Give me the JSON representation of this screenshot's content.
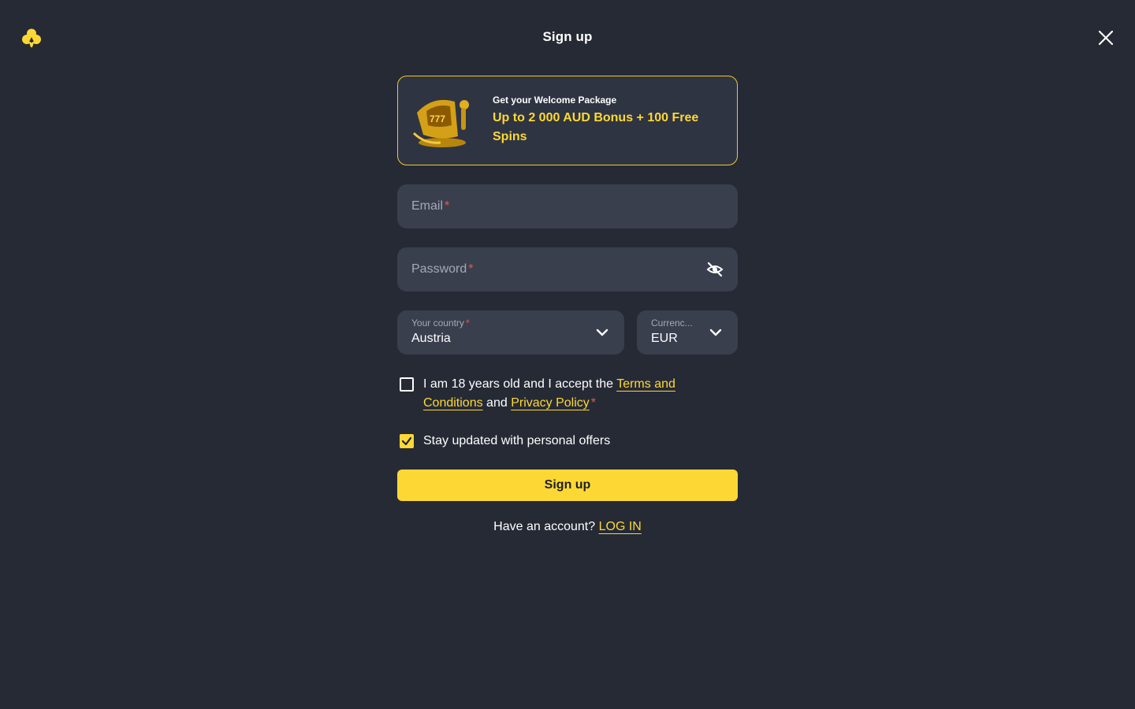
{
  "header": {
    "title": "Sign up"
  },
  "icons": {
    "logo": "club-logo-icon",
    "close": "close-icon",
    "password_toggle": "eye-off-icon",
    "chevron": "chevron-down-icon",
    "check": "check-icon"
  },
  "promo": {
    "heading": "Get your Welcome Package",
    "offer": "Up to 2 000 AUD Bonus + 100 Free Spins"
  },
  "form": {
    "email_label": "Email",
    "password_label": "Password",
    "required_mark": "*",
    "country": {
      "label": "Your country",
      "value": "Austria"
    },
    "currency": {
      "label": "Currenc...",
      "value": "EUR"
    },
    "terms": {
      "text_before": "I am 18 years old and I accept the ",
      "terms_link": "Terms and Conditions",
      "text_between": " and ",
      "privacy_link": "Privacy Policy",
      "checked": false
    },
    "offers": {
      "text": "Stay updated with personal offers",
      "checked": true
    },
    "submit_label": "Sign up",
    "login_prompt": "Have an account? ",
    "login_link": "LOG IN"
  },
  "colors": {
    "background": "#262a35",
    "accent": "#fdd835",
    "field": "#3a3f4e",
    "required": "#e8594a"
  }
}
